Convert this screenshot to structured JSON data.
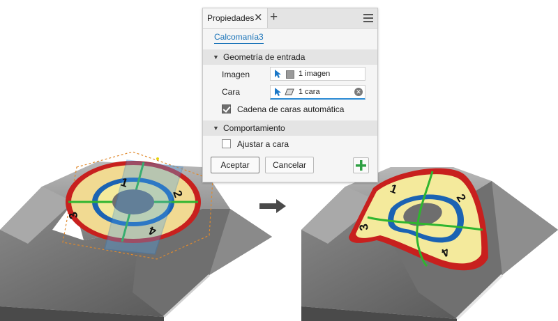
{
  "panel": {
    "tab_title": "Propiedades",
    "close_glyph": "✕",
    "add_glyph": "+",
    "feature_name": "Calcomanía3",
    "section_input": {
      "title": "Geometría de entrada",
      "image_label": "Imagen",
      "image_value": "1 imagen",
      "face_label": "Cara",
      "face_value": "1 cara",
      "chain_faces_label": "Cadena de caras automática",
      "chain_faces_checked": true
    },
    "section_behavior": {
      "title": "Comportamiento",
      "wrap_label": "Ajustar a cara",
      "wrap_checked": false
    },
    "ok_label": "Aceptar",
    "cancel_label": "Cancelar"
  },
  "decal_left": {
    "labels": [
      "1",
      "2",
      "3",
      "4"
    ]
  },
  "decal_right": {
    "labels": [
      "1",
      "2",
      "3",
      "4"
    ]
  },
  "colors": {
    "panel_bg": "#f5f5f5",
    "link_blue": "#1a73b8",
    "decal_red": "#c8201e",
    "decal_blue": "#1b63b3",
    "decal_green": "#2fb52f",
    "decal_fill": "#f4ea9c",
    "add_green": "#2ea043"
  },
  "icons": [
    "close-icon",
    "add-icon",
    "menu-icon",
    "cursor-icon",
    "image-icon",
    "face-icon",
    "clear-icon",
    "arrow-right-icon",
    "plus-icon"
  ]
}
